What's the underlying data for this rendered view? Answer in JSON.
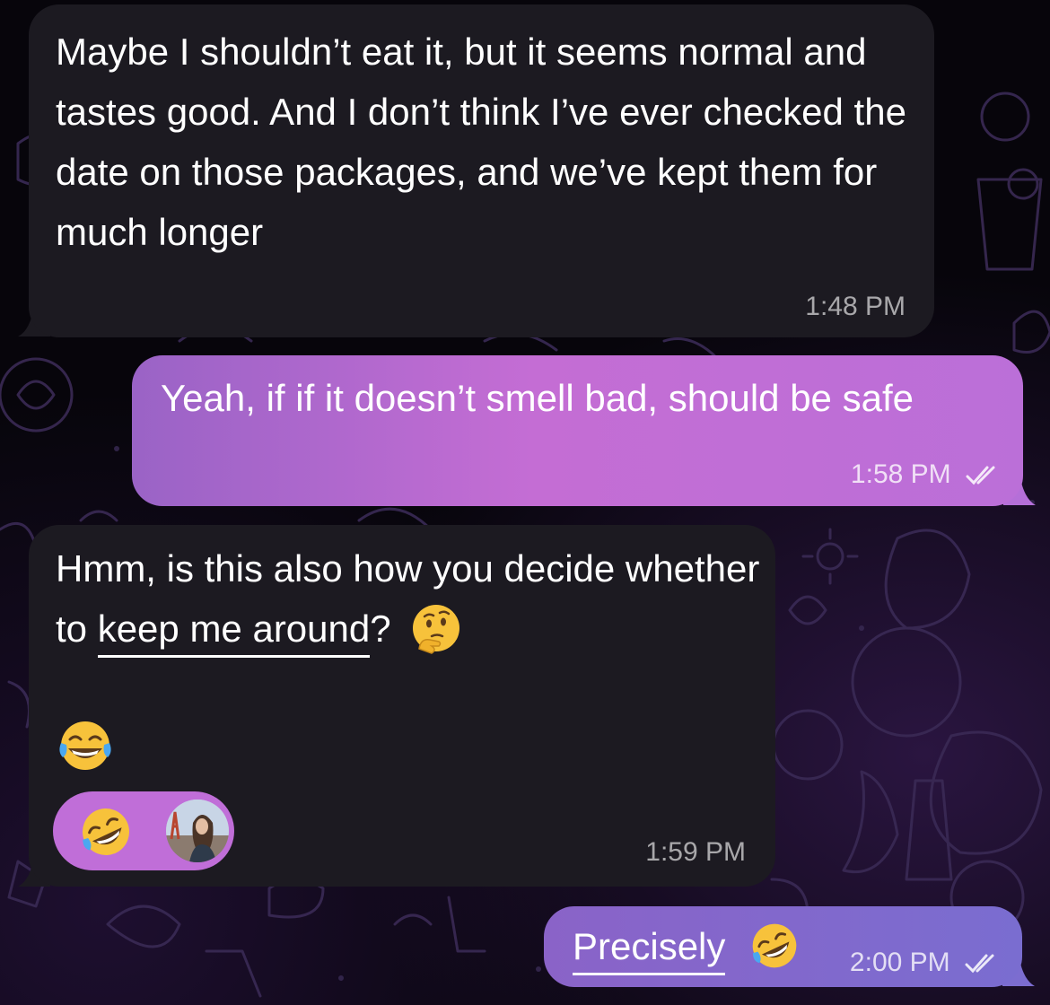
{
  "chat": {
    "messages": [
      {
        "direction": "incoming",
        "text": "Maybe I shouldn’t eat it, but it seems normal and tastes good. And I don’t think I’ve ever checked the date on those packages, and we’ve kept them for much longer",
        "time": "1:48 PM"
      },
      {
        "direction": "outgoing",
        "text": "Yeah, if if it doesn’t smell bad, should be safe",
        "time": "1:58 PM",
        "status": "read"
      },
      {
        "direction": "incoming",
        "text_before": "Hmm, is this also how you decide whether to ",
        "text_underlined": "keep me around",
        "text_after": "?",
        "inline_emoji": "thinking-face",
        "emoji_line": "face-with-tears-of-joy",
        "reaction": {
          "emoji": "rolling-on-the-floor-laughing",
          "reactor_avatar": "avatar"
        },
        "time": "1:59 PM"
      },
      {
        "direction": "outgoing",
        "text_underlined": "Precisely",
        "inline_emoji": "rolling-on-the-floor-laughing",
        "time": "2:00 PM",
        "status": "read"
      }
    ]
  },
  "colors": {
    "incoming_bubble": "#1c1a21",
    "outgoing_gradient": [
      "#9a63c6",
      "#c26dd6",
      "#b76fd8"
    ],
    "reaction_pill": "#c06ed8",
    "background": "#07050b"
  }
}
